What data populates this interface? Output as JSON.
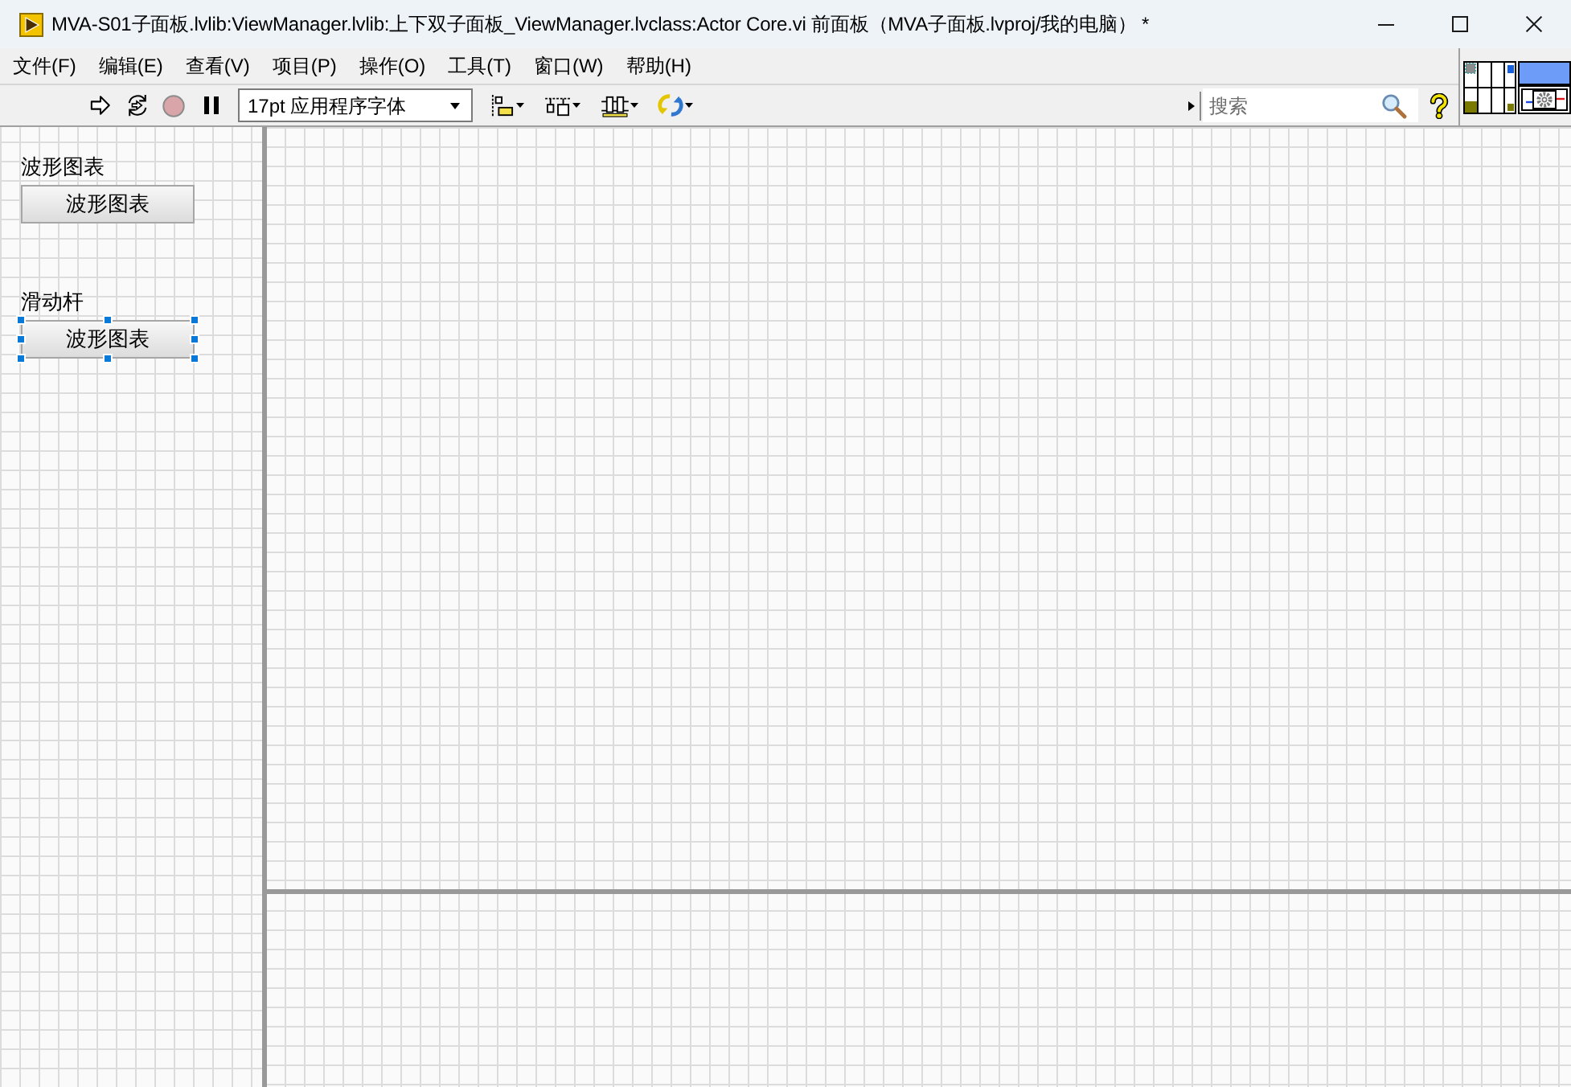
{
  "window": {
    "title": "MVA-S01子面板.lvlib:ViewManager.lvlib:上下双子面板_ViewManager.lvclass:Actor Core.vi 前面板（MVA子面板.lvproj/我的电脑） *",
    "controls": [
      {
        "kind": "minimize"
      },
      {
        "kind": "maximize"
      },
      {
        "kind": "close"
      }
    ]
  },
  "menu_bar": {
    "items": [
      {
        "label": "文件(F)"
      },
      {
        "label": "编辑(E)"
      },
      {
        "label": "查看(V)"
      },
      {
        "label": "项目(P)"
      },
      {
        "label": "操作(O)"
      },
      {
        "label": "工具(T)"
      },
      {
        "label": "窗口(W)"
      },
      {
        "label": "帮助(H)"
      }
    ]
  },
  "toolbar": {
    "run_buttons": [
      {
        "kind": "run",
        "disabled": false
      },
      {
        "kind": "run_continuously",
        "disabled": false
      },
      {
        "kind": "abort",
        "disabled": true
      },
      {
        "kind": "pause",
        "disabled": false
      }
    ],
    "font": {
      "value": "17pt 应用程序字体"
    },
    "tools": [
      {
        "kind": "align"
      },
      {
        "kind": "distribute"
      },
      {
        "kind": "resize"
      },
      {
        "kind": "reorder"
      }
    ],
    "search": {
      "placeholder": "搜索"
    }
  },
  "front_panel": {
    "controls": [
      {
        "label": "波形图表",
        "button_text": "波形图表",
        "selected": false
      },
      {
        "label": "滑动杆",
        "button_text": "波形图表",
        "selected": true
      }
    ]
  }
}
